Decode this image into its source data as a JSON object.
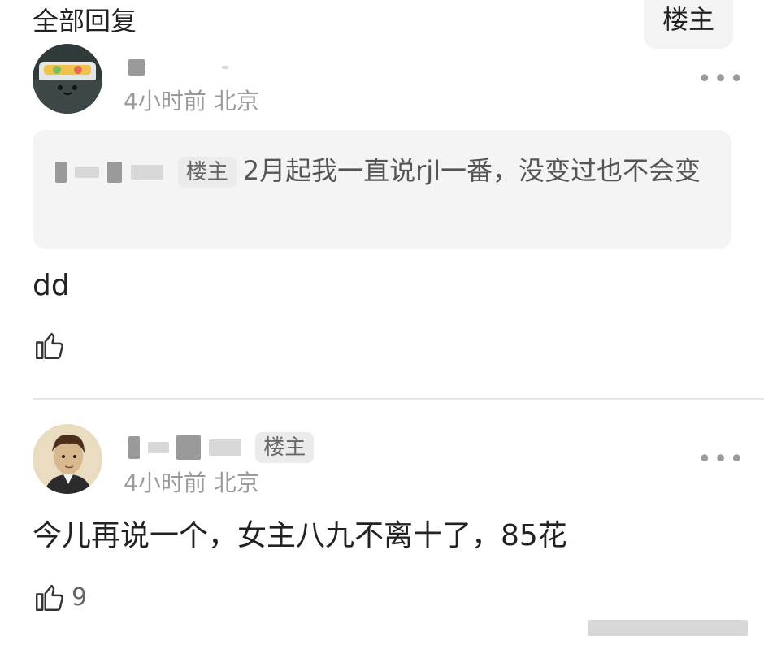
{
  "header": {
    "title": "全部回复",
    "owner_tab": "楼主"
  },
  "replies": [
    {
      "meta": "4小时前 北京",
      "quote": {
        "badge": "楼主",
        "text": "2月起我一直说rjl一番，没变过也不会变"
      },
      "text": "dd",
      "likes": ""
    },
    {
      "badge": "楼主",
      "meta": "4小时前 北京",
      "text": "今儿再说一个，女主八九不离十了，85花",
      "likes": "9"
    }
  ],
  "icons": {
    "more": "more-icon",
    "like": "thumbs-up-icon"
  }
}
